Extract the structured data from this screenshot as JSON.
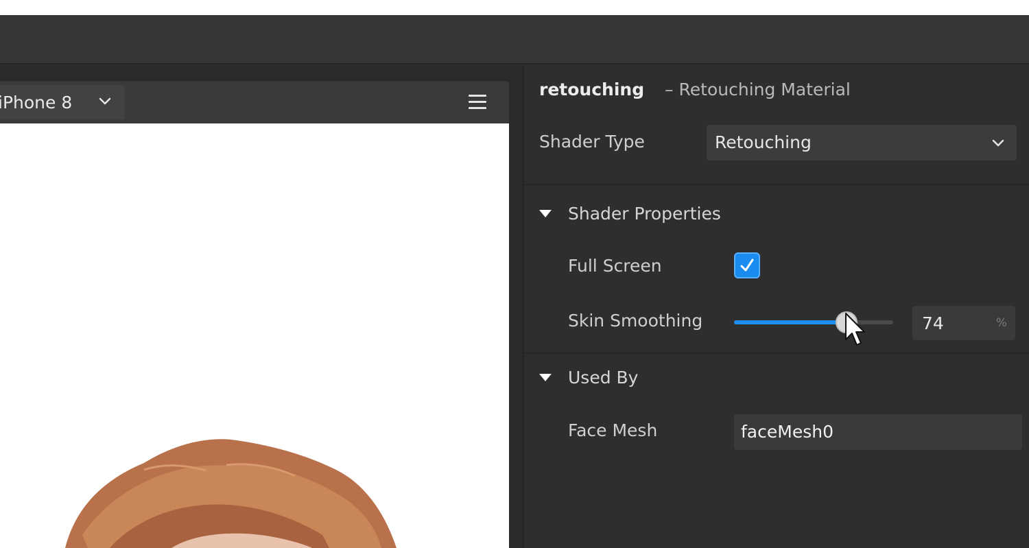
{
  "viewport": {
    "device_label": "iPhone 8",
    "device_chevron_icon": "chevron-down-icon",
    "menu_icon": "hamburger-menu-icon"
  },
  "inspector": {
    "title_name": "retouching",
    "title_sub": "– Retouching Material",
    "shader_type": {
      "label": "Shader Type",
      "value": "Retouching"
    },
    "shader_properties": {
      "label": "Shader Properties",
      "full_screen": {
        "label": "Full Screen",
        "checked": true
      },
      "skin_smoothing": {
        "label": "Skin Smoothing",
        "value": "74",
        "unit": "%",
        "fraction": 0.74
      }
    },
    "used_by": {
      "label": "Used By",
      "face_mesh": {
        "label": "Face Mesh",
        "value": "faceMesh0"
      }
    }
  },
  "colors": {
    "accent": "#1f8ef2",
    "panel_bg": "#2e2e2e",
    "hair": "#b8714a"
  }
}
